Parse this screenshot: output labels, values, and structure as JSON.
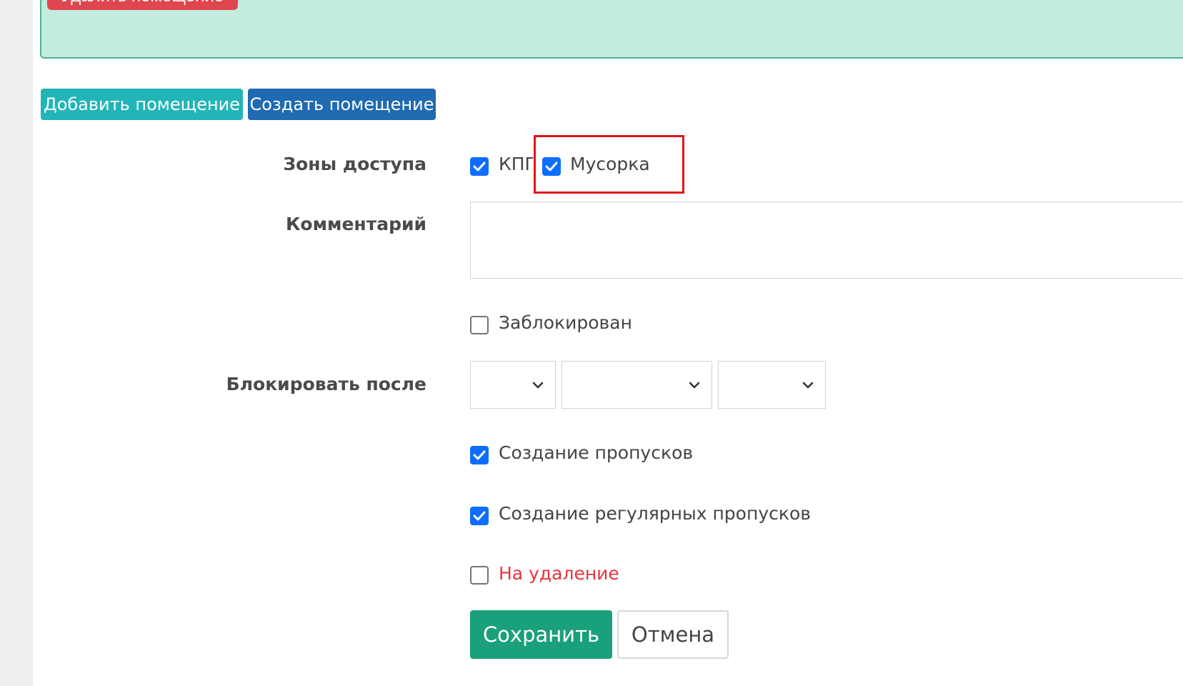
{
  "top_panel": {
    "delete_button": "Удалить помещение"
  },
  "buttons": {
    "add_room": "Добавить помещение",
    "create_room": "Создать помещение"
  },
  "form": {
    "access_zones_label": "Зоны доступа",
    "zones": [
      {
        "label": "КПП",
        "checked": true
      },
      {
        "label": "Мусорка",
        "checked": true
      }
    ],
    "comment_label": "Комментарий",
    "comment_value": "",
    "blocked_label": "Заблокирован",
    "blocked_checked": false,
    "block_after_label": "Блокировать после",
    "block_after_selects": [
      "",
      "",
      ""
    ],
    "create_passes_label": "Создание пропусков",
    "create_passes_checked": true,
    "create_regular_passes_label": "Создание регулярных пропусков",
    "create_regular_passes_checked": true,
    "for_deletion_label": "На удаление",
    "for_deletion_checked": false,
    "save_button": "Сохранить",
    "cancel_button": "Отмена"
  },
  "colors": {
    "panel_bg": "#c3ece0",
    "add_btn": "#22b5b8",
    "create_btn": "#1f6ab1",
    "checkbox_on": "#0d6efd",
    "save_btn": "#1aa07a",
    "danger": "#e3343f",
    "highlight": "#e3121a"
  },
  "icons": [
    "checkmark-icon",
    "chevron-down-icon"
  ]
}
